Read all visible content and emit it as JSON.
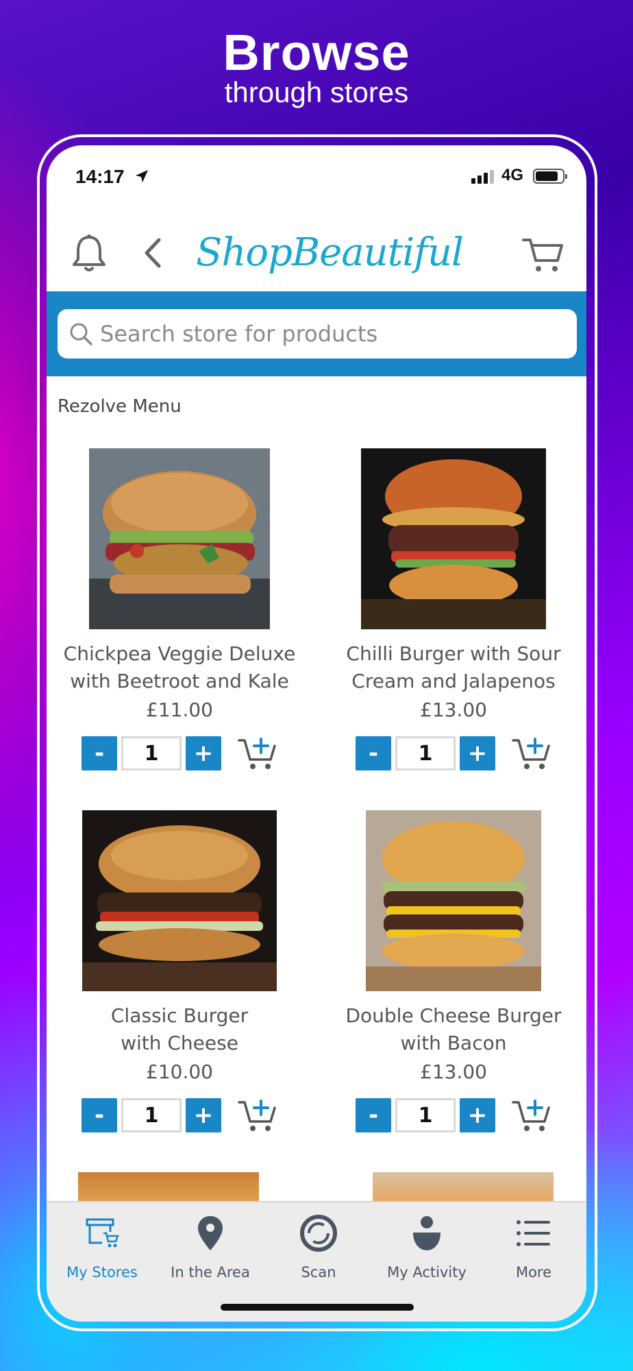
{
  "headline": {
    "title": "Browse",
    "subtitle": "through stores"
  },
  "status_bar": {
    "time": "14:17",
    "network": "4G"
  },
  "app": {
    "logo_text": "ShopBeautiful",
    "accent_color": "#1886c7",
    "logo_color": "#1aa7d0"
  },
  "search": {
    "placeholder": "Search store for products"
  },
  "section": {
    "title": "Rezolve Menu"
  },
  "products": [
    {
      "name_line1": "Chickpea Veggie Deluxe",
      "name_line2": "with Beetroot and Kale",
      "price": "£11.00",
      "qty": "1"
    },
    {
      "name_line1": "Chilli Burger with Sour",
      "name_line2": "Cream and Jalapenos",
      "price": "£13.00",
      "qty": "1"
    },
    {
      "name_line1": "Classic Burger",
      "name_line2": "with Cheese",
      "price": "£10.00",
      "qty": "1"
    },
    {
      "name_line1": "Double Cheese Burger",
      "name_line2": "with Bacon",
      "price": "£13.00",
      "qty": "1"
    }
  ],
  "qty_controls": {
    "minus": "-",
    "plus": "+"
  },
  "bottom_nav": [
    {
      "label": "My Stores",
      "icon": "store-cart-icon",
      "active": true
    },
    {
      "label": "In the Area",
      "icon": "map-pin-icon",
      "active": false
    },
    {
      "label": "Scan",
      "icon": "scan-icon",
      "active": false
    },
    {
      "label": "My Activity",
      "icon": "person-icon",
      "active": false
    },
    {
      "label": "More",
      "icon": "menu-list-icon",
      "active": false
    }
  ]
}
